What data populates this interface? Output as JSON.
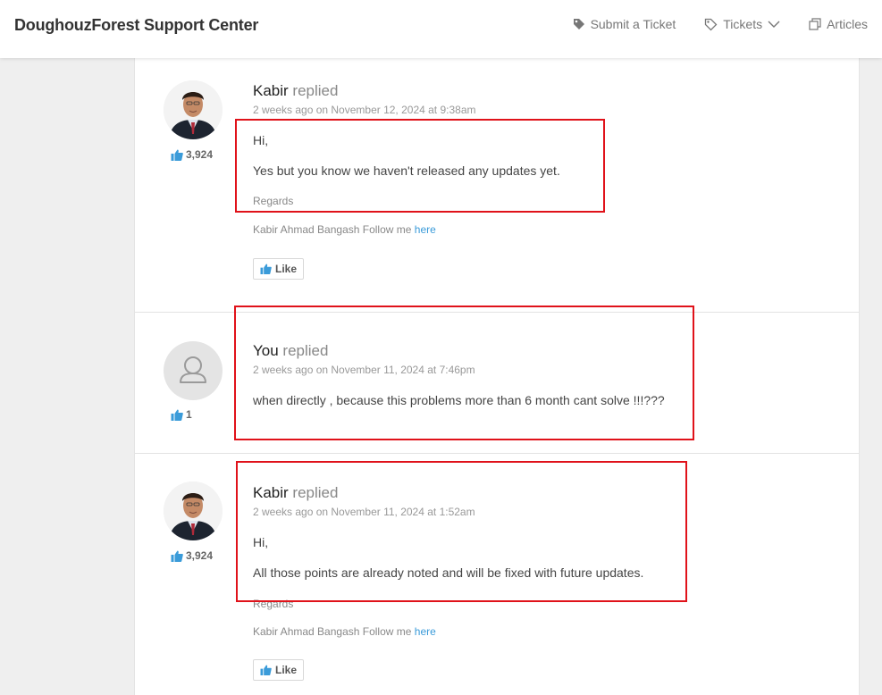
{
  "header": {
    "brand": "DoughouzForest Support Center",
    "nav": {
      "submit_ticket": "Submit a Ticket",
      "tickets": "Tickets",
      "articles": "Articles"
    }
  },
  "replies": [
    {
      "author": "Kabir",
      "verb": "replied",
      "meta": "2 weeks ago on November 12, 2024 at 9:38am",
      "likes": "3,924",
      "lines": [
        "Hi,",
        "Yes but you know we haven't released any updates yet."
      ],
      "regards": "Regards",
      "signature": "Kabir Ahmad Bangash Follow me",
      "signature_link": "here",
      "like_label": "Like"
    },
    {
      "author": "You",
      "verb": "replied",
      "meta": "2 weeks ago on November 11, 2024 at 7:46pm",
      "likes": "1",
      "lines": [
        "when directly , because this problems more than 6 month cant solve !!!???"
      ]
    },
    {
      "author": "Kabir",
      "verb": "replied",
      "meta": "2 weeks ago on November 11, 2024 at 1:52am",
      "likes": "3,924",
      "lines": [
        "Hi,",
        "All those points are already noted and will be fixed with future updates."
      ],
      "regards": "Regards",
      "signature": "Kabir Ahmad Bangash Follow me",
      "signature_link": "here",
      "like_label": "Like"
    }
  ],
  "colors": {
    "accent_blue": "#3a9bd9",
    "highlight_red": "#e0121a"
  }
}
